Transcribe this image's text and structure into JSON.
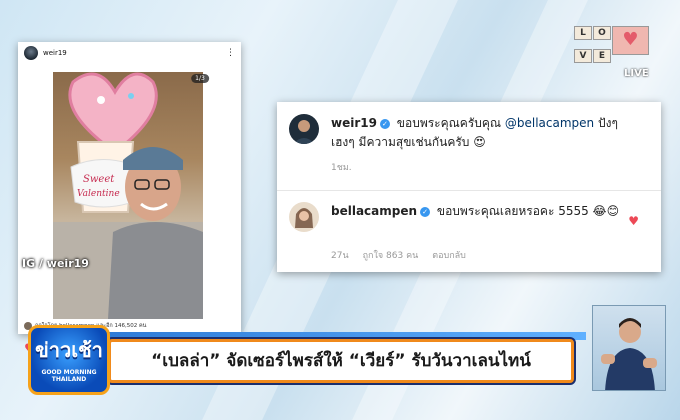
{
  "post": {
    "username": "weir19",
    "photo_counter": "1/3",
    "watermark": "IG / weir19",
    "likes_text": "ถูกใจโดย bellacampen และอีก 146,502 คน",
    "balloon_text": "Sweet Valentine"
  },
  "comments": [
    {
      "username": "weir19",
      "text_prefix": "ขอบพระคุณครับคุณ",
      "mention": "@bellacampen",
      "text_suffix": "ปังๆ เฮงๆ มีความสุขเช่นกันครับ 😍",
      "time": "1ชม."
    },
    {
      "username": "bellacampen",
      "text": "ขอบพระคุณเลยหรอคะ 5555 😂😊",
      "time": "27น",
      "likes": "ถูกใจ 863 คน",
      "reply_label": "ตอบกลับ"
    }
  ],
  "headline": "“เบลล่า” จัดเซอร์ไพรส์ให้ “เวียร์” รับวันวาเลนไทน์",
  "show_logo": {
    "title": "ข่าวเช้า",
    "line1": "GOOD MORNING",
    "line2": "THAILAND"
  },
  "channel": {
    "tiles": [
      "L",
      "O",
      "V",
      "E"
    ],
    "live": "LIVE"
  },
  "colors": {
    "verified": "#3897f0",
    "heart": "#ed4956",
    "headline_border": "#f08a1c",
    "show_logo_blue": "#0a4bb8"
  }
}
